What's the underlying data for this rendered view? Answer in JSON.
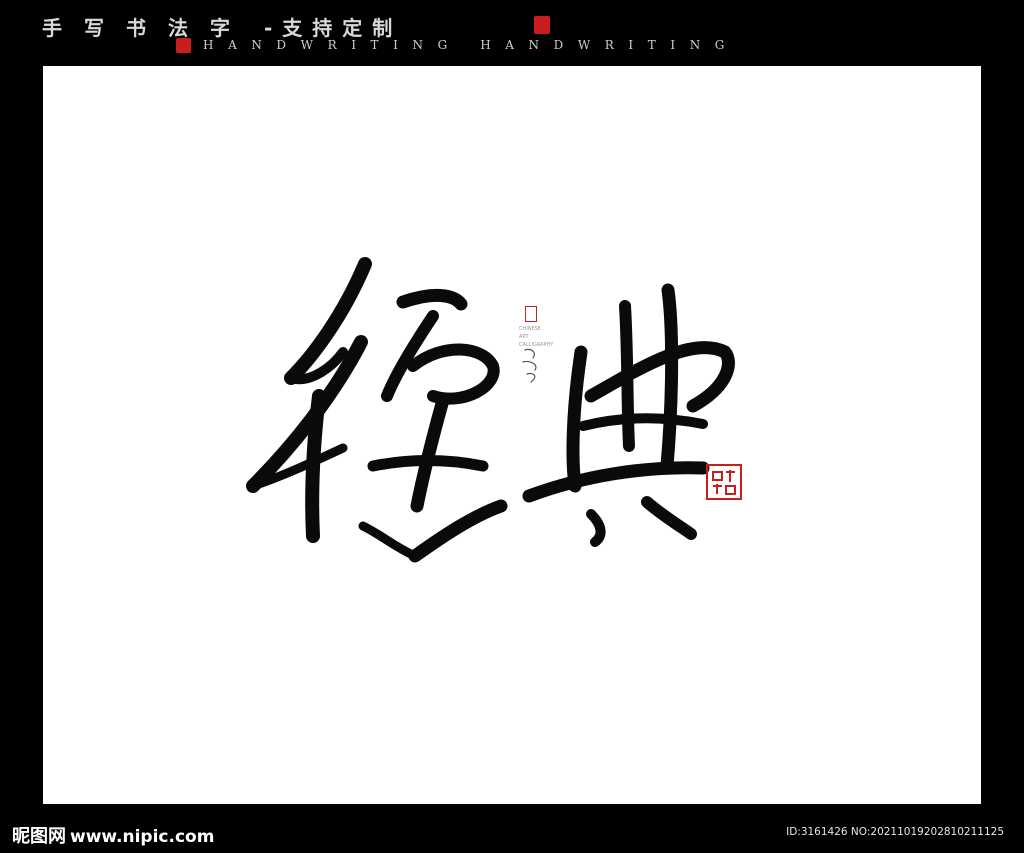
{
  "header": {
    "title_main": "手写书法字",
    "title_sub": "-支持定制",
    "handwriting": "HANDWRITING HANDWRITING"
  },
  "artwork": {
    "glyphs": "經典",
    "mini_signature_lines": [
      "CHINESE",
      "ART",
      "CALLIGRAPHY"
    ]
  },
  "footer": {
    "logo_text": "昵图网",
    "logo_url": "www.nipic.com",
    "id_line": "ID:3161426 NO:20211019202810211125"
  },
  "colors": {
    "background": "#000000",
    "canvas": "#ffffff",
    "ink": "#0a0a0a",
    "seal_red": "#c81e1e"
  }
}
